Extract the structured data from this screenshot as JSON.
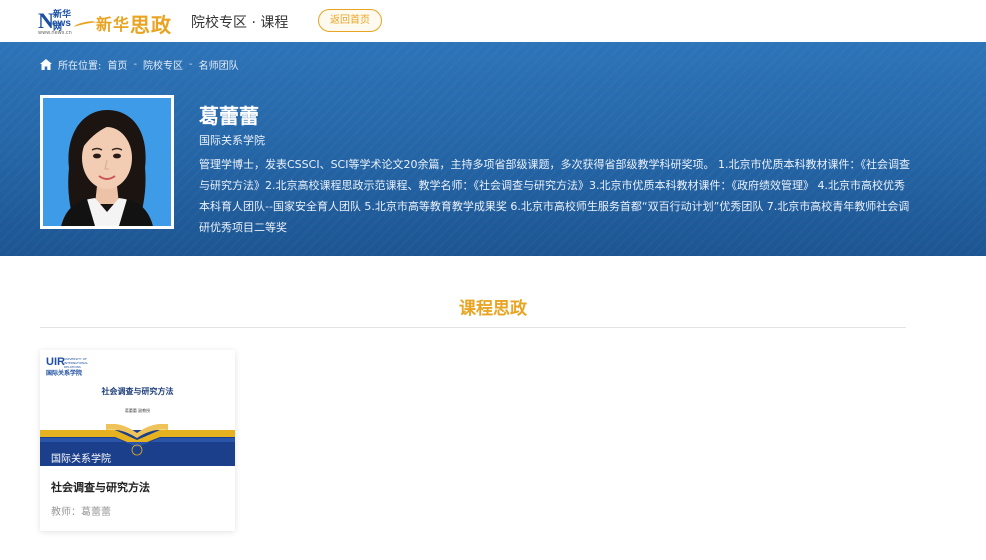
{
  "header": {
    "logo_news_letter": "N",
    "logo_news_rest": "ews",
    "logo_news_cn": "新华网",
    "logo_url": "www.news.cn",
    "logo_name_plain": "新华",
    "logo_name_brush": "思政",
    "nav_title": "院校专区 · 课程",
    "back_button": "返回首页",
    "accent_color": "#e8a422"
  },
  "breadcrumb": {
    "prefix": "所在位置:",
    "items": [
      "首页",
      "院校专区",
      "名师团队"
    ],
    "separator": "-"
  },
  "teacher": {
    "name": "葛蕾蕾",
    "department": "国际关系学院",
    "bio": "管理学博士，发表CSSCI、SCI等学术论文20余篇，主持多项省部级课题，多次获得省部级教学科研奖项。 1.北京市优质本科教材课件：《社会调查与研究方法》2.北京高校课程思政示范课程、教学名师：《社会调查与研究方法》3.北京市优质本科教材课件：《政府绩效管理》 4.北京市高校优秀本科育人团队--国家安全育人团队 5.北京市高等教育教学成果奖 6.北京市高校师生服务首都“双百行动计划”优秀团队 7.北京市高校青年教师社会调研优秀项目二等奖"
  },
  "section": {
    "title": "课程思政"
  },
  "courses": [
    {
      "cover_logo_abbr": "UIR",
      "cover_logo_en": "UNIVERSITY OF INTERNATIONAL RELATIONS",
      "cover_logo_cn": "国际关系学院",
      "cover_title": "社会调查与研究方法",
      "cover_authors": "葛蕾蕾 副教授",
      "cover_label": "国际关系学院",
      "title": "社会调查与研究方法",
      "teacher": "教师：葛蕾蕾"
    }
  ],
  "colors": {
    "banner_top": "#2d74b8",
    "banner_bottom": "#1d5592",
    "section_title": "#e8a422"
  }
}
